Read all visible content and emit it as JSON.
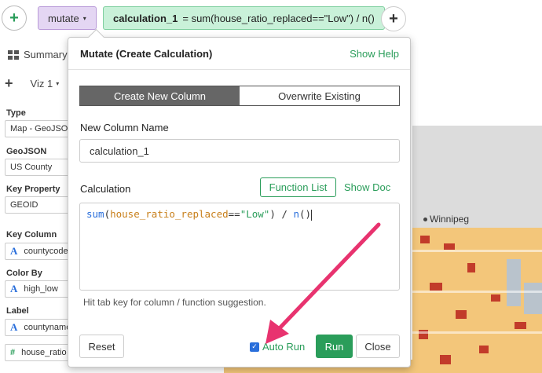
{
  "topbar": {
    "add_step_symbol": "+",
    "step_label": "mutate",
    "step_caret": "▾",
    "expression_target": "calculation_1",
    "expression_rest": "= sum(house_ratio_replaced==\"Low\") / n()",
    "add_after_symbol": "+"
  },
  "left_panel": {
    "summary_tab": "Summary",
    "add_viz_symbol": "+",
    "viz_label": "Viz 1",
    "viz_caret": "▾",
    "properties": [
      {
        "label": "Type",
        "value": "Map - GeoJSON",
        "type_icon": ""
      },
      {
        "label": "GeoJSON",
        "value": "US County",
        "type_icon": ""
      },
      {
        "label": "Key Property",
        "value": "GEOID",
        "type_icon": ""
      },
      {
        "label": "Key Column",
        "value": "countycode",
        "type_icon": "A"
      },
      {
        "label": "Color By",
        "value": "high_low",
        "type_icon": "A"
      },
      {
        "label": "Label",
        "value": "countyname",
        "type_icon": "A"
      },
      {
        "label": "",
        "value": "house_ratio",
        "type_icon": "#"
      }
    ]
  },
  "map": {
    "city_label": "Winnipeg"
  },
  "dialog": {
    "title": "Mutate (Create Calculation)",
    "show_help": "Show Help",
    "tabs": [
      {
        "label": "Create New Column",
        "active": true
      },
      {
        "label": "Overwrite Existing",
        "active": false
      }
    ],
    "new_column_label": "New Column Name",
    "new_column_value": "calculation_1",
    "calculation_label": "Calculation",
    "function_list_button": "Function List",
    "show_doc": "Show Doc",
    "code": {
      "fn": "sum",
      "open_paren": "(",
      "column": "house_ratio_replaced",
      "op": "==",
      "string": "\"Low\"",
      "close_paren": ")",
      "divide": " / ",
      "fn2": "n",
      "fn2_parens": "()"
    },
    "hint": "Hit tab key for column / function suggestion.",
    "reset_button": "Reset",
    "auto_run_label": "Auto Run",
    "auto_run_checked": true,
    "run_button": "Run",
    "close_button": "Close"
  },
  "colors": {
    "accent_green": "#2a9d5a",
    "mutate_purple": "#e4d6f3",
    "expr_green": "#c9f1d9",
    "annotation_pink": "#e8336f"
  }
}
